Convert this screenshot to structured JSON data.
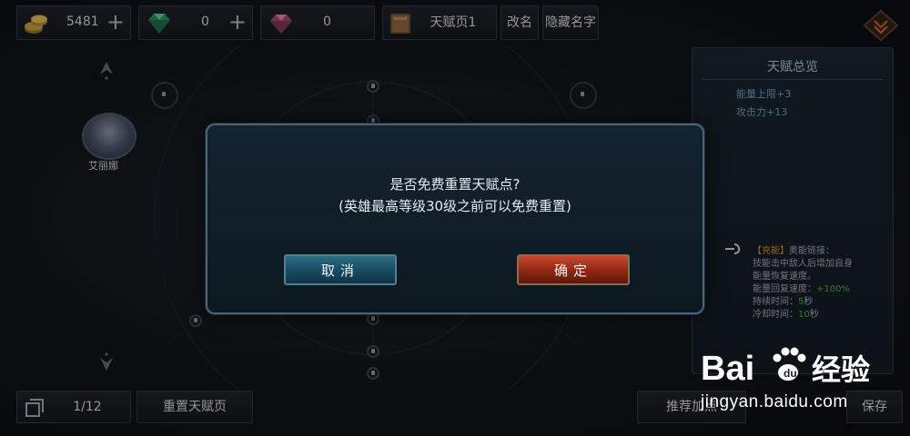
{
  "resources": {
    "gold": {
      "value": "5481",
      "icon": "gold-coins-icon"
    },
    "emerald": {
      "value": "0",
      "icon": "green-gem-icon"
    },
    "ruby": {
      "value": "0",
      "icon": "red-gem-icon"
    }
  },
  "topbar": {
    "talent_page_label": "天赋页1",
    "rename_label": "改名",
    "hide_name_label": "隐藏名字",
    "plus_glyph": "+"
  },
  "hero": {
    "name": "艾丽娜"
  },
  "panel": {
    "title": "天赋总览",
    "stats": [
      "能量上限+3",
      "攻击力+13"
    ],
    "skill": {
      "tag": "【充能】",
      "name": "奥能链接：",
      "desc_line1": "技能击中敌人后增加自身",
      "desc_line2": "能量恢复速度。",
      "speed_label": "能量回复速度：",
      "speed_value": "+100%",
      "duration_label": "持续时间：",
      "duration_value": "5",
      "duration_unit": "秒",
      "cooldown_label": "冷却时间：",
      "cooldown_value": "10",
      "cooldown_unit": "秒"
    }
  },
  "bottombar": {
    "page_count": "1/12",
    "reset_label": "重置天赋页",
    "recommend_label": "推荐加点",
    "save_label": "保存"
  },
  "dialog": {
    "line1": "是否免费重置天赋点?",
    "line2": "(英雄最高等级30级之前可以免费重置)",
    "cancel_label": "取消",
    "confirm_label": "确定"
  },
  "watermark": {
    "logo_text_left": "Bai",
    "logo_text_right": "经验",
    "url": "jingyan.baidu.com"
  },
  "colors": {
    "cancel_button": "#1f5a72",
    "confirm_button": "#a8361c",
    "dialog_border": "#4d6478",
    "stat_text": "#6f95b8",
    "green_highlight": "#4ca343",
    "orange_tag": "#d38a2b"
  }
}
